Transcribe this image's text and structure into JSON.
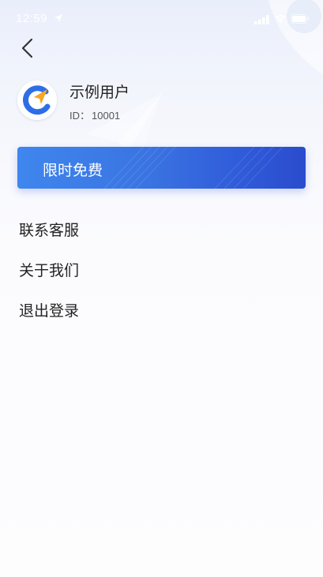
{
  "status_bar": {
    "time": "12:59"
  },
  "nav": {
    "back_icon": "chevron-left-icon"
  },
  "profile": {
    "avatar_icon": "app-logo-icon",
    "name": "示例用户",
    "id_label": "ID：",
    "id_value": "10001"
  },
  "promo": {
    "label": "限时免费"
  },
  "menu": {
    "items": [
      {
        "label": "联系客服"
      },
      {
        "label": "关于我们"
      },
      {
        "label": "退出登录"
      }
    ]
  },
  "colors": {
    "accent": "#3a74e2",
    "accent_dark": "#2a4ccd",
    "logo_orange": "#f5a623",
    "logo_blue": "#2d6ee8"
  }
}
